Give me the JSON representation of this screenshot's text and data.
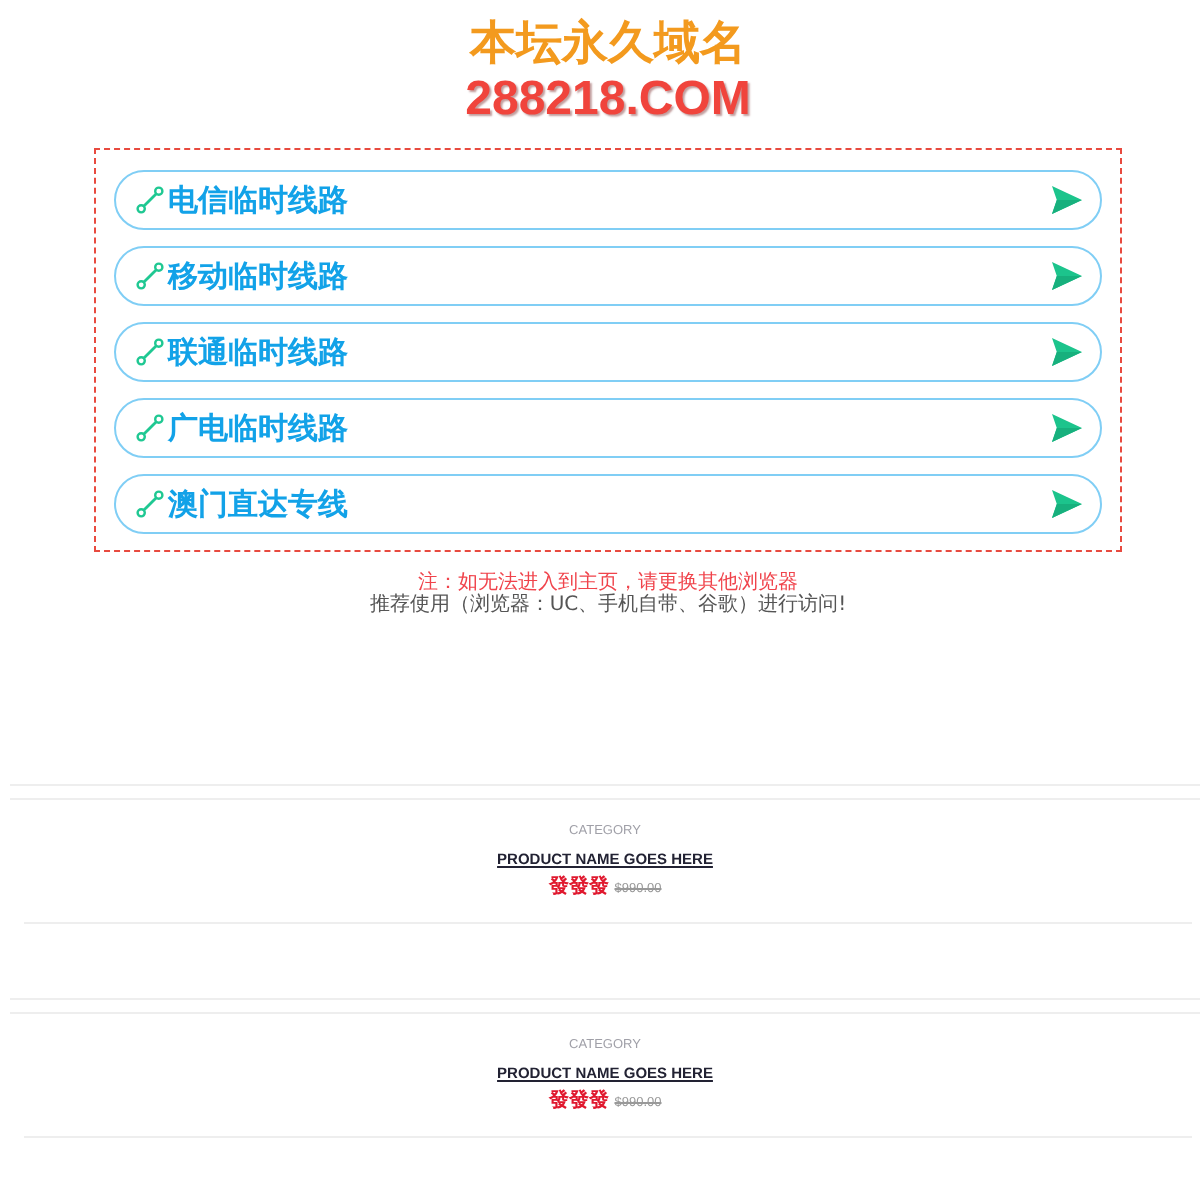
{
  "header": {
    "title": "本坛永久域名",
    "domain": "288218.COM"
  },
  "lines": [
    {
      "label": "电信临时线路"
    },
    {
      "label": "移动临时线路"
    },
    {
      "label": "联通临时线路"
    },
    {
      "label": "广电临时线路"
    },
    {
      "label": "澳门直达专线"
    }
  ],
  "notes": {
    "warning": "注：如无法进入到主页，请更换其他浏览器",
    "tip": "推荐使用（浏览器：UC、手机自带、谷歌）进行访问!"
  },
  "products": [
    {
      "category": "CATEGORY",
      "name": "PRODUCT NAME GOES HERE",
      "price": "發發發",
      "old_price": "$990.00"
    },
    {
      "category": "CATEGORY",
      "name": "PRODUCT NAME GOES HERE",
      "price": "發發發",
      "old_price": "$990.00"
    }
  ]
}
